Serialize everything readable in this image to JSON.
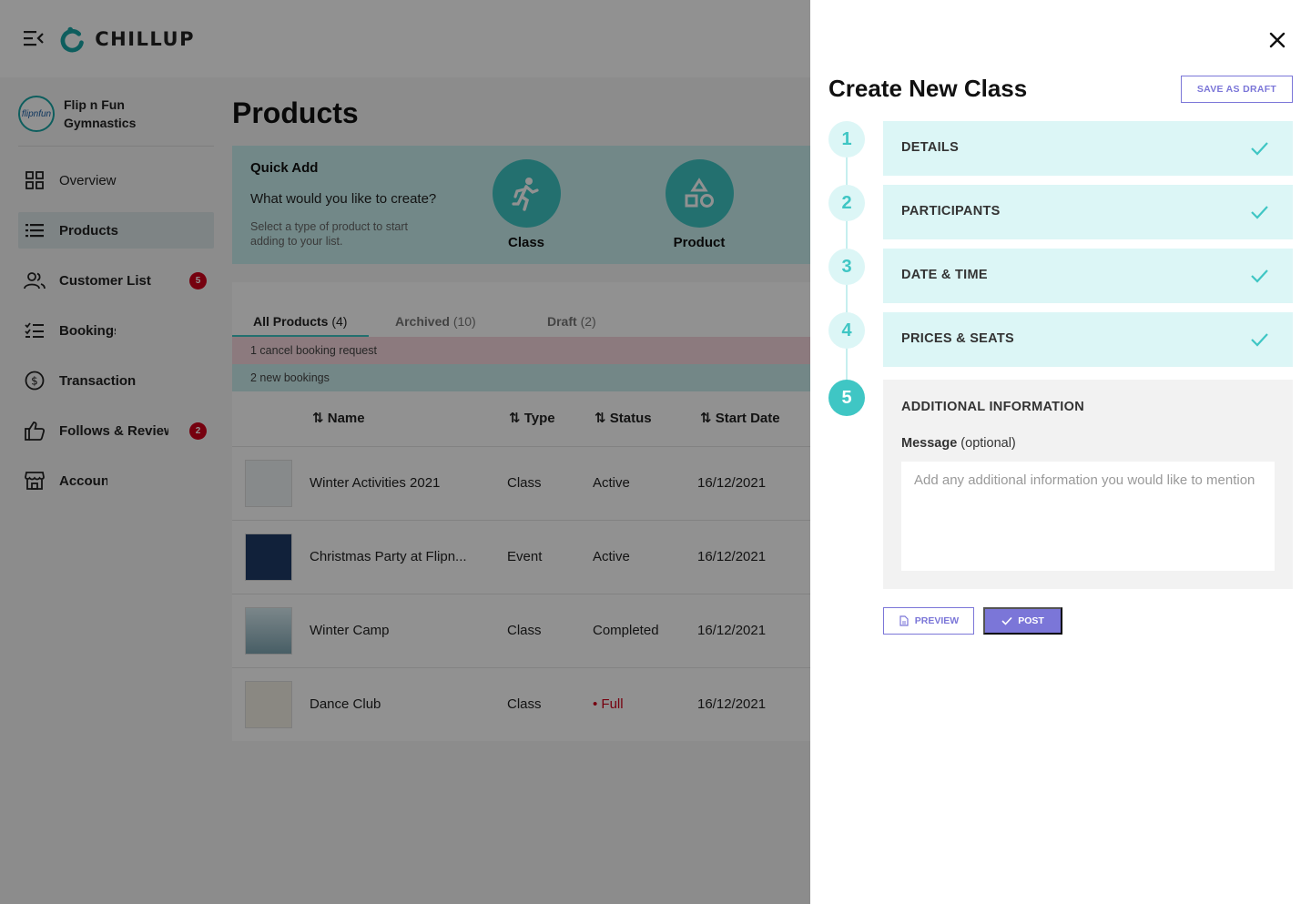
{
  "app": {
    "brand": "CHILLUP",
    "org_name": "Flip n Fun Gymnastics",
    "org_avatar_text": "flipnfun"
  },
  "nav": {
    "overview": "Overview",
    "products": "Products",
    "customers": "Customer List",
    "customers_badge": "5",
    "bookings": "Bookings",
    "transactions": "Transactions",
    "follows": "Follows & Reviews",
    "follows_badge": "2",
    "account": "Account"
  },
  "main": {
    "title": "Products",
    "quick_add": {
      "title": "Quick Add",
      "question": "What would you like to create?",
      "hint": "Select a type of product to start adding to your list.",
      "class_label": "Class",
      "product_label": "Product"
    },
    "tabs": [
      {
        "label": "All Products",
        "count": "(4)"
      },
      {
        "label": "Archived",
        "count": "(10)"
      },
      {
        "label": "Draft",
        "count": "(2)"
      }
    ],
    "alerts": {
      "cancel": "1 cancel booking request",
      "new": "2 new bookings"
    },
    "columns": [
      "Name",
      "Type",
      "Status",
      "Start Date"
    ],
    "rows": [
      {
        "name": "Winter Activities 2021",
        "type": "Class",
        "status": "Active",
        "date": "16/12/2021"
      },
      {
        "name": "Christmas Party at Flipn...",
        "type": "Event",
        "status": "Active",
        "date": "16/12/2021"
      },
      {
        "name": "Winter Camp",
        "type": "Class",
        "status": "Completed",
        "date": "16/12/2021"
      },
      {
        "name": "Dance Club",
        "type": "Class",
        "status": "• Full",
        "date": "16/12/2021"
      }
    ]
  },
  "drawer": {
    "title": "Create New Class",
    "save_draft": "SAVE AS DRAFT",
    "steps": [
      {
        "num": "1",
        "label": "DETAILS"
      },
      {
        "num": "2",
        "label": "PARTICIPANTS"
      },
      {
        "num": "3",
        "label": "DATE & TIME"
      },
      {
        "num": "4",
        "label": "PRICES & SEATS"
      },
      {
        "num": "5",
        "label": "ADDITIONAL INFORMATION"
      }
    ],
    "message_label": "Message",
    "message_optional": "(optional)",
    "message_placeholder": "Add any additional information you would like to mention",
    "preview": "PREVIEW",
    "post": "POST"
  },
  "colors": {
    "accent": "#3fc6c4",
    "primary_button": "#7b76d8",
    "badge": "#d0021b"
  }
}
